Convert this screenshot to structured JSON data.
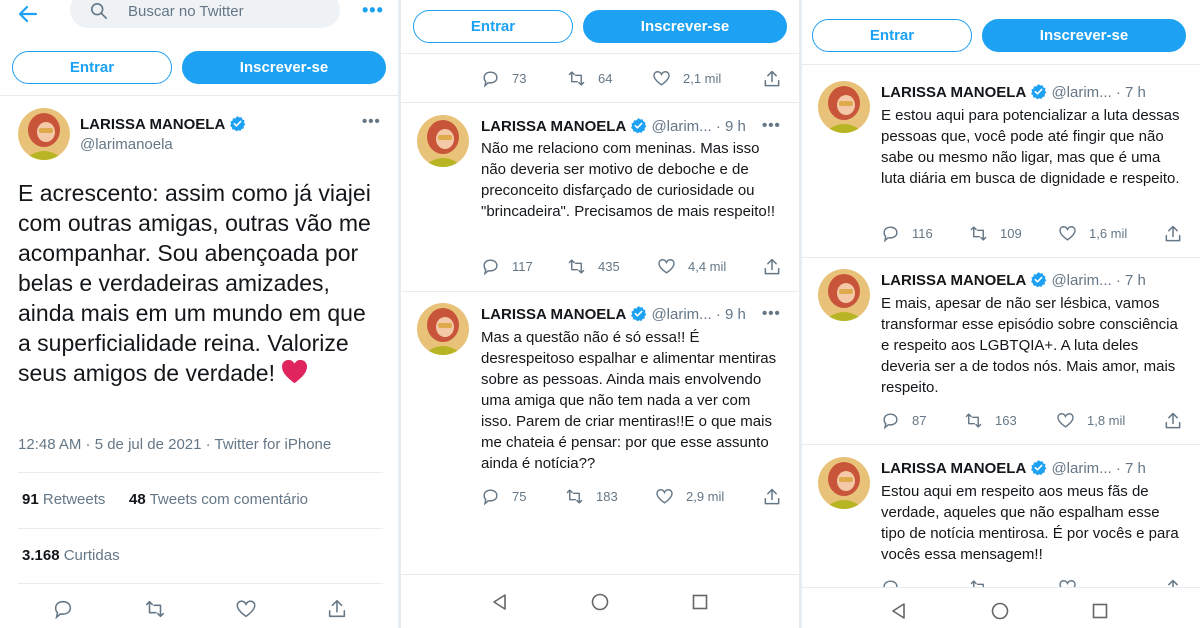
{
  "colors": {
    "accent": "#1da1f2",
    "text": "#14171a",
    "muted": "#657786",
    "heart": "#e0245e"
  },
  "search": {
    "placeholder": "Buscar no Twitter"
  },
  "buttons": {
    "login": "Entrar",
    "signup": "Inscrever-se"
  },
  "main_tweet": {
    "name": "LARISSA MANOELA",
    "handle": "@larimanoela",
    "text": "E acrescento: assim como já viajei com outras amigas, outras vão me acompanhar. Sou abençoada por belas e verdadeiras amizades, ainda mais em um mundo em que a superficialidade reina. Valorize seus amigos de verdade!",
    "meta": "12:48 AM · 5 de jul de 2021 · Twitter for iPhone",
    "retweets_count": "91",
    "retweets_label": "Retweets",
    "quotes_count": "48",
    "quotes_label": "Tweets com comentário",
    "likes_count": "3.168",
    "likes_label": "Curtidas"
  },
  "panel2": {
    "top_actions": {
      "replies": "73",
      "retweets": "64",
      "likes": "2,1 mil"
    },
    "tweets": [
      {
        "name": "LARISSA MANOELA",
        "handle": "@larim...",
        "time": "9 h",
        "text": "Não me relaciono com meninas. Mas isso não deveria ser motivo de deboche e de preconceito disfarçado de curiosidade ou \"brincadeira\". Precisamos de mais respeito!!",
        "replies": "117",
        "retweets": "435",
        "likes": "4,4 mil"
      },
      {
        "name": "LARISSA MANOELA",
        "handle": "@larim...",
        "time": "9 h",
        "text": "Mas a questão não é só essa!! É desrespeitoso espalhar e alimentar mentiras sobre as pessoas. Ainda mais envolvendo uma amiga que não tem nada a ver com isso. Parem de criar mentiras!!E o que mais me chateia é pensar: por que esse assunto ainda é notícia??",
        "replies": "75",
        "retweets": "183",
        "likes": "2,9 mil"
      }
    ]
  },
  "panel3": {
    "tweets": [
      {
        "name": "LARISSA MANOELA",
        "handle": "@larim...",
        "time": "7 h",
        "text": "E estou aqui para potencializar a luta dessas pessoas que, você pode até fingir que não sabe ou mesmo não ligar, mas que é uma luta diária em busca de dignidade e respeito.",
        "replies": "116",
        "retweets": "109",
        "likes": "1,6 mil"
      },
      {
        "name": "LARISSA MANOELA",
        "handle": "@larim...",
        "time": "7 h",
        "text": "E mais, apesar de não ser lésbica, vamos transformar esse episódio sobre consciência e respeito aos LGBTQIA+. A luta deles deveria ser a de todos nós. Mais amor, mais respeito.",
        "replies": "87",
        "retweets": "163",
        "likes": "1,8 mil"
      },
      {
        "name": "LARISSA MANOELA",
        "handle": "@larim...",
        "time": "7 h",
        "text": "Estou aqui em respeito aos meus fãs de verdade, aqueles que não espalham esse tipo de notícia mentirosa. É por vocês e para vocês essa mensagem!!",
        "replies": "",
        "retweets": "",
        "likes": ""
      }
    ]
  }
}
